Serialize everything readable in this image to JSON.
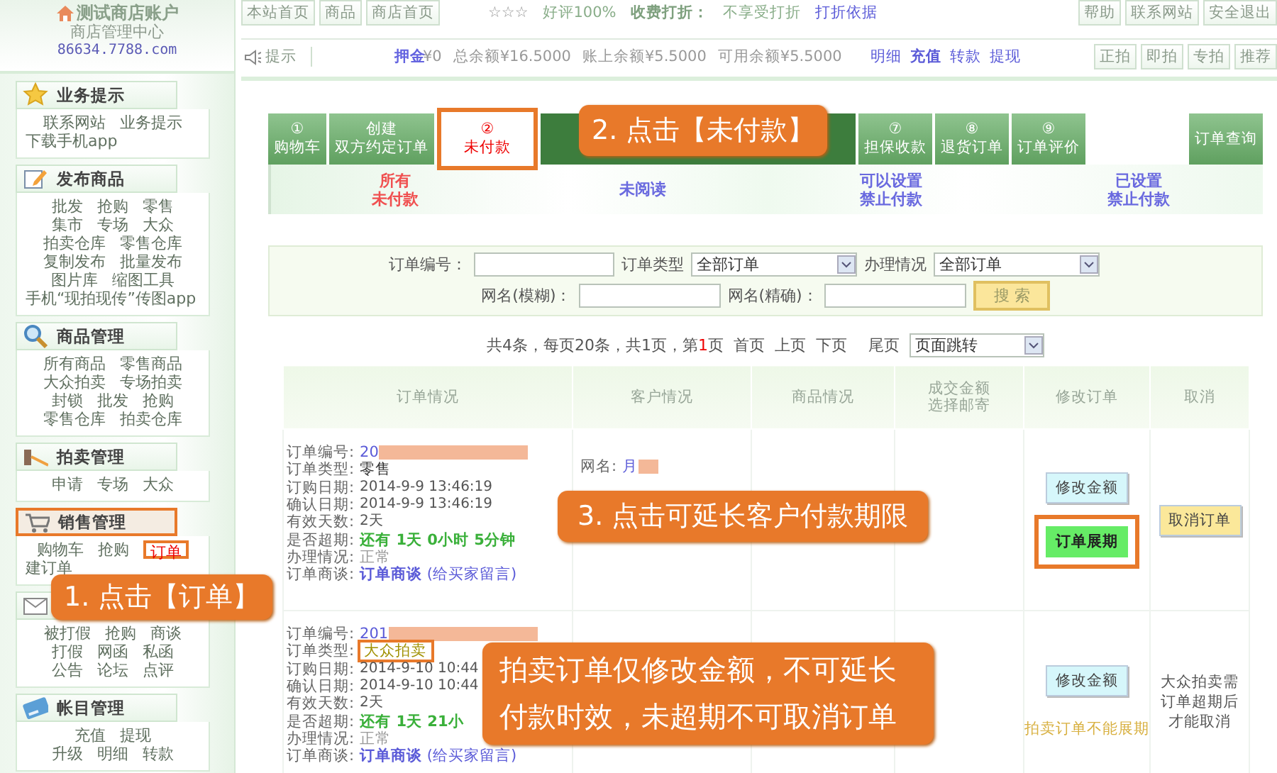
{
  "store": {
    "name": "测试商店账户",
    "subtitle": "商店管理中心",
    "domain": "86634.7788.com"
  },
  "sidebar": {
    "sections": [
      {
        "title": "业务提示",
        "annotated": false,
        "rows": [
          [
            {
              "label": "联系网站",
              "selected": false
            },
            {
              "label": "业务提示",
              "selected": false
            }
          ],
          [
            {
              "label": "下载手机app",
              "selected": false
            }
          ]
        ]
      },
      {
        "title": "发布商品",
        "annotated": false,
        "rows": [
          [
            {
              "label": "批发",
              "selected": false
            },
            {
              "label": "抢购",
              "selected": false
            },
            {
              "label": "零售",
              "selected": false
            }
          ],
          [
            {
              "label": "集市",
              "selected": false
            },
            {
              "label": "专场",
              "selected": false
            },
            {
              "label": "大众",
              "selected": false
            }
          ],
          [
            {
              "label": "拍卖仓库",
              "selected": false
            },
            {
              "label": "零售仓库",
              "selected": false
            }
          ],
          [
            {
              "label": "复制发布",
              "selected": false
            },
            {
              "label": "批量发布",
              "selected": false
            }
          ],
          [
            {
              "label": "图片库",
              "selected": false
            },
            {
              "label": "缩图工具",
              "selected": false
            }
          ],
          [
            {
              "label": "手机“现拍现传”传图app",
              "selected": false
            }
          ]
        ]
      },
      {
        "title": "商品管理",
        "annotated": false,
        "rows": [
          [
            {
              "label": "所有商品",
              "selected": false
            },
            {
              "label": "零售商品",
              "selected": false
            }
          ],
          [
            {
              "label": "大众拍卖",
              "selected": false
            },
            {
              "label": "专场拍卖",
              "selected": false
            }
          ],
          [
            {
              "label": "封锁",
              "selected": false
            },
            {
              "label": "批发",
              "selected": false
            },
            {
              "label": "抢购",
              "selected": false
            }
          ],
          [
            {
              "label": "零售仓库",
              "selected": false
            },
            {
              "label": "拍卖仓库",
              "selected": false
            }
          ]
        ]
      },
      {
        "title": "拍卖管理",
        "annotated": false,
        "rows": [
          [
            {
              "label": "申请",
              "selected": false
            },
            {
              "label": "专场",
              "selected": false
            },
            {
              "label": "大众",
              "selected": false
            }
          ]
        ]
      },
      {
        "title": "销售管理",
        "annotated": true,
        "rows": [
          [
            {
              "label": "购物车",
              "selected": false
            },
            {
              "label": "抢购",
              "selected": false
            },
            {
              "label": "订单",
              "selected": true
            }
          ],
          [
            {
              "label": "建订单",
              "selected": false
            }
          ]
        ]
      },
      {
        "annotated": false,
        "rows": [
          [
            {
              "label": "被打假",
              "selected": false
            },
            {
              "label": "抢购",
              "selected": false
            },
            {
              "label": "商谈",
              "selected": false
            }
          ],
          [
            {
              "label": "打假",
              "selected": false
            },
            {
              "label": "网函",
              "selected": false
            },
            {
              "label": "私函",
              "selected": false
            }
          ],
          [
            {
              "label": "公告",
              "selected": false
            },
            {
              "label": "论坛",
              "selected": false
            },
            {
              "label": "点评",
              "selected": false
            }
          ]
        ]
      },
      {
        "title": "帐目管理",
        "annotated": false,
        "rows": [
          [
            {
              "label": "充值",
              "selected": false
            },
            {
              "label": "提现",
              "selected": false
            }
          ],
          [
            {
              "label": "升级",
              "selected": false
            },
            {
              "label": "明细",
              "selected": false
            },
            {
              "label": "转款",
              "selected": false
            }
          ]
        ]
      }
    ]
  },
  "top_bar": {
    "nav": [
      "本站首页",
      "商品",
      "商店首页"
    ],
    "stars": "☆☆☆",
    "rating": "好评100%",
    "discount_label": "收费打折：",
    "discount_value": "不享受打折",
    "discount_link": "打折依据",
    "right_nav": [
      "帮助",
      "联系网站",
      "安全退出"
    ]
  },
  "account_bar": {
    "tip": "提示",
    "deposit_label": "押金",
    "deposit_value": "¥0",
    "balances": [
      "总余额¥16.5000",
      "账上余额¥5.5000",
      "可用余额¥5.5000"
    ],
    "links": [
      {
        "label": "明细",
        "bold": false
      },
      {
        "label": "充值",
        "bold": true
      },
      {
        "label": "转款",
        "bold": false
      },
      {
        "label": "提现",
        "bold": false
      }
    ],
    "buttons": [
      "正拍",
      "即拍",
      "专拍",
      "推荐"
    ]
  },
  "tabs": [
    {
      "kind": "step",
      "lines": [
        "①",
        "购物车"
      ],
      "selected": false,
      "annotated": false
    },
    {
      "kind": "step",
      "lines": [
        "创建",
        "双方约定订单"
      ],
      "selected": false,
      "annotated": false
    },
    {
      "kind": "step",
      "lines": [
        "②",
        "未付款"
      ],
      "selected": true,
      "annotated": true
    },
    {
      "kind": "step",
      "lines": [
        "⑦",
        "担保收款"
      ],
      "selected": false,
      "annotated": false
    },
    {
      "kind": "step",
      "lines": [
        "⑧",
        "退货订单"
      ],
      "selected": false,
      "annotated": false
    },
    {
      "kind": "step",
      "lines": [
        "⑨",
        "订单评价"
      ],
      "selected": false,
      "annotated": false
    },
    {
      "kind": "query",
      "lines": [
        "订单查询"
      ],
      "selected": false,
      "annotated": false
    }
  ],
  "sub_tabs": [
    {
      "lines": [
        "所有",
        "未付款"
      ],
      "selected": true
    },
    {
      "lines": [
        "未阅读"
      ],
      "selected": false
    },
    {
      "lines": [
        "可以设置",
        "禁止付款"
      ],
      "selected": false
    },
    {
      "lines": [
        "已设置",
        "禁止付款"
      ],
      "selected": false
    }
  ],
  "search": {
    "rows": [
      [
        {
          "kind": "input",
          "label": "订单编号："
        },
        {
          "kind": "select",
          "label": "订单类型",
          "value": "全部订单"
        },
        {
          "kind": "select",
          "label": "办理情况",
          "value": "全部订单"
        }
      ],
      [
        {
          "kind": "input",
          "label": "网名(模糊)："
        },
        {
          "kind": "input",
          "label": "网名(精确)："
        },
        {
          "kind": "button",
          "label": "搜 索"
        }
      ]
    ]
  },
  "pager": {
    "summary_before": "共4条，每页20条，共1页，第",
    "current": "1",
    "summary_after": "页",
    "links": [
      "首页",
      "上页",
      "下页",
      "尾页"
    ],
    "jump": "页面跳转"
  },
  "table": {
    "columns": [
      {
        "lines": [
          "订单情况"
        ]
      },
      {
        "lines": [
          "客户情况"
        ]
      },
      {
        "lines": [
          "商品情况"
        ]
      },
      {
        "lines": [
          "成交金额",
          "选择邮寄"
        ]
      },
      {
        "lines": [
          "修改订单"
        ]
      },
      {
        "lines": [
          "取消"
        ]
      }
    ],
    "rows": [
      {
        "fields": [
          {
            "label": "订单编号:",
            "value": "20",
            "kind": "link",
            "redacted": true,
            "annotated": false
          },
          {
            "label": "订单类型:",
            "value": "零售",
            "kind": "plain",
            "redacted": false,
            "annotated": false
          },
          {
            "label": "订购日期:",
            "value": "2014-9-9 13:46:19",
            "kind": "date",
            "redacted": false,
            "annotated": false
          },
          {
            "label": "确认日期:",
            "value": "2014-9-9 13:46:19",
            "kind": "date",
            "redacted": false,
            "annotated": false
          },
          {
            "label": "有效天数:",
            "value": "2天",
            "kind": "date",
            "redacted": false,
            "annotated": false
          },
          {
            "label": "是否超期:",
            "value": "还有 1天 0小时 5分钟",
            "kind": "green",
            "redacted": false,
            "annotated": false
          },
          {
            "label": "办理情况:",
            "value": "正常",
            "kind": "muted",
            "redacted": false,
            "annotated": false
          },
          {
            "label": "订单商谈:",
            "value": "**订单商谈** (给买家留言)",
            "kind": "link",
            "redacted": false,
            "annotated": false
          }
        ],
        "customer": {
          "label": "网名:",
          "value": "月",
          "redacted": true
        },
        "edit_actions": [
          {
            "kind": "edit",
            "label": "修改金额",
            "annotated": false
          },
          {
            "kind": "extend",
            "label": "订单展期",
            "annotated": true
          }
        ],
        "cancel_action": {
          "kind": "cancel",
          "label": "取消订单"
        }
      },
      {
        "fields": [
          {
            "label": "订单编号:",
            "value": "201",
            "kind": "link",
            "redacted": true,
            "annotated": false
          },
          {
            "label": "订单类型:",
            "value": "大众拍卖",
            "kind": "auction",
            "redacted": false,
            "annotated": true
          },
          {
            "label": "订购日期:",
            "value": "2014-9-10 10:44",
            "kind": "date",
            "redacted": false,
            "annotated": false
          },
          {
            "label": "确认日期:",
            "value": "2014-9-10 10:44",
            "kind": "date",
            "redacted": false,
            "annotated": false
          },
          {
            "label": "有效天数:",
            "value": "2天",
            "kind": "date",
            "redacted": false,
            "annotated": false
          },
          {
            "label": "是否超期:",
            "value": "还有 1天 21小",
            "kind": "green",
            "redacted": false,
            "annotated": false
          },
          {
            "label": "办理情况:",
            "value": "正常",
            "kind": "muted",
            "redacted": false,
            "annotated": false
          },
          {
            "label": "订单商谈:",
            "value": "**订单商谈** (给买家留言)",
            "kind": "link",
            "redacted": false,
            "annotated": false
          }
        ],
        "edit_actions": [
          {
            "kind": "edit",
            "label": "修改金额",
            "annotated": false
          },
          {
            "kind": "note",
            "label": "拍卖订单不能展期",
            "annotated": false
          }
        ],
        "cancel_action": {
          "kind": "note",
          "label": "大众拍卖需订单超期后才能取消"
        }
      }
    ]
  },
  "callouts": [
    {
      "text": "1. 点击【订单】"
    },
    {
      "text": "2. 点击【未付款】"
    },
    {
      "text": "3. 点击可延长客户付款期限"
    },
    {
      "text": "拍卖订单仅修改金额，不可延长付款时效，未超期不可取消订单"
    }
  ]
}
